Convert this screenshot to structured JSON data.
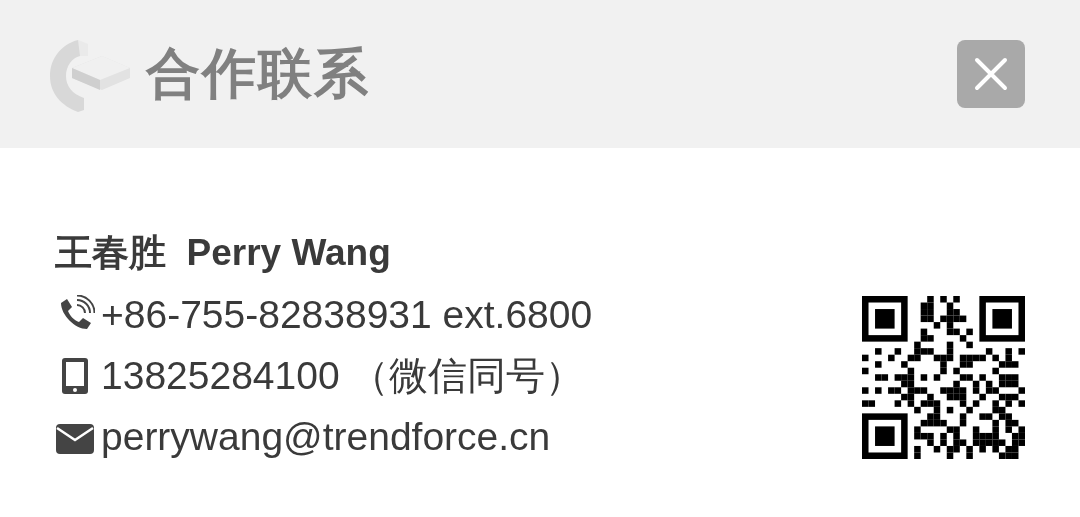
{
  "header": {
    "title": "合作联系"
  },
  "contact": {
    "name": "王春胜  Perry Wang",
    "lines": [
      {
        "kind": "phone",
        "text": "+86-755-82838931 ext.6800"
      },
      {
        "kind": "mobile",
        "text": "13825284100 （微信同号）"
      },
      {
        "kind": "email",
        "text": "perrywang@trendforce.cn"
      }
    ]
  }
}
